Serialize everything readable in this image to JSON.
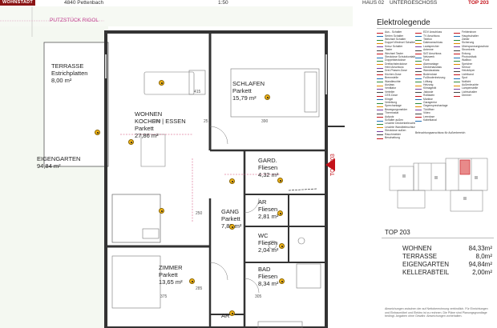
{
  "header": {
    "logo": "WOHNSTADT",
    "address": "4840 Pettenbach",
    "scale": "1:50",
    "house": "HAUS 02",
    "floor": "UNTERGESCHOSS",
    "unit": "TOP 203"
  },
  "plan": {
    "rooms": [
      {
        "name": "TERRASSE",
        "floor": "Estrichplatten",
        "area": "8,00 m²"
      },
      {
        "name": "WOHNEN\nKOCHEN | ESSEN",
        "floor": "Parkett",
        "area": "27,86 m²"
      },
      {
        "name": "SCHLAFEN",
        "floor": "Parkett",
        "area": "15,79 m²"
      },
      {
        "name": "EIGENGARTEN",
        "floor": "",
        "area": "94,84 m²"
      },
      {
        "name": "GARD.",
        "floor": "Fliesen",
        "area": "4,32 m²"
      },
      {
        "name": "AR",
        "floor": "Fliesen",
        "area": "2,81 m²"
      },
      {
        "name": "GANG",
        "floor": "Parkett",
        "area": "7,87 m²"
      },
      {
        "name": "WC",
        "floor": "Fliesen",
        "area": "2,04 m²"
      },
      {
        "name": "ZIMMER",
        "floor": "Parkett",
        "area": "13,65 m²"
      },
      {
        "name": "BAD",
        "floor": "Fliesen",
        "area": "8,34 m²"
      },
      {
        "name": "AR",
        "floor": "",
        "area": ""
      }
    ],
    "putz_label": "PUTZSTÜCK RIGOL",
    "dimensions": [
      "390",
      "390",
      "415",
      "250",
      "285",
      "375",
      "305",
      "25"
    ],
    "top_tag": "TOP 203"
  },
  "legend": {
    "title": "Elektrolegende",
    "items_col1": [
      "Aus - Schalter",
      "Serien Schalter",
      "Wechsel Schalter",
      "Doppel Wechsel Schalter",
      "Kreuz Schalter",
      "Taster",
      "Wechsel Taster",
      "Steckdose Schutzkontakt",
      "Doppelsteckdose",
      "Dreifachsteckdose",
      "Herd Anschluss",
      "Drei-Phasen-Dose",
      "Küchen-Dose",
      "Brennstelle",
      "Wandleuchte",
      "Auslass",
      "Ventilator",
      "Verteiler",
      "CEE-Dose",
      "Klingel",
      "Verteilung",
      "Sprechanlage",
      "Bewegungsmelder",
      "Thermostat",
      "Aufputz",
      "Schalter außen",
      "Leuchte Deckenbeleuchtung",
      "Leuchte Wandbeleuchtung",
      "Steckdose außen",
      "Rauchmelder",
      "Beschattung"
    ],
    "items_col2": [
      "EDV Anschluss",
      "TV Anschluss",
      "Telefon",
      "Datenanschluss",
      "Lautsprecher",
      "Antenne",
      "SAT Anschluss",
      "Netzwerk",
      "Funk",
      "Alarmanlage",
      "Deckenauslass",
      "Wandauslass",
      "Bodendose",
      "Fußbodenheizung",
      "Lüftung",
      "Heizung",
      "Klimagerät",
      "Jalousie",
      "Rollladen",
      "Markise",
      "Garagentor",
      "Gegensprechanlage",
      "Türöffner",
      "Video",
      "Leerdose",
      "Kabelkanal"
    ],
    "items_col3": [
      "Fehlerstrom",
      "Hauptschalter",
      "Zähler",
      "Sicherung",
      "Überspannungsschutz",
      "Stromkreis",
      "Erdung",
      "Photovoltaik",
      "Wallbox",
      "Speicher",
      "Sensor",
      "Heizkörper",
      "Lichtband",
      "Spot",
      "Notlicht",
      "Außenleuchte",
      "Lampenstelle",
      "Lichtschalter",
      "Dimmer"
    ],
    "note": "Beleuchtungsanschluss für Außenbereich"
  },
  "summary": {
    "title": "TOP 203",
    "rows": [
      {
        "label": "WOHNEN",
        "value": "84,33m²"
      },
      {
        "label": "TERRASSE",
        "value": "8,0m²"
      },
      {
        "label": "EIGENGARTEN",
        "value": "94,84m²"
      },
      {
        "label": "KELLERABTEIL",
        "value": "2,00m²"
      }
    ],
    "footnote": "Abweichungen zwischen der auf Nettoberechnung verbindlich. Für Einrichtungen und Einbaumöbel und Elektro ist zu rechnen. Die Pläne sind Planungsgrundlage bedingt. Angaben ohne Gewähr. Abweichungen vorbehalten."
  }
}
